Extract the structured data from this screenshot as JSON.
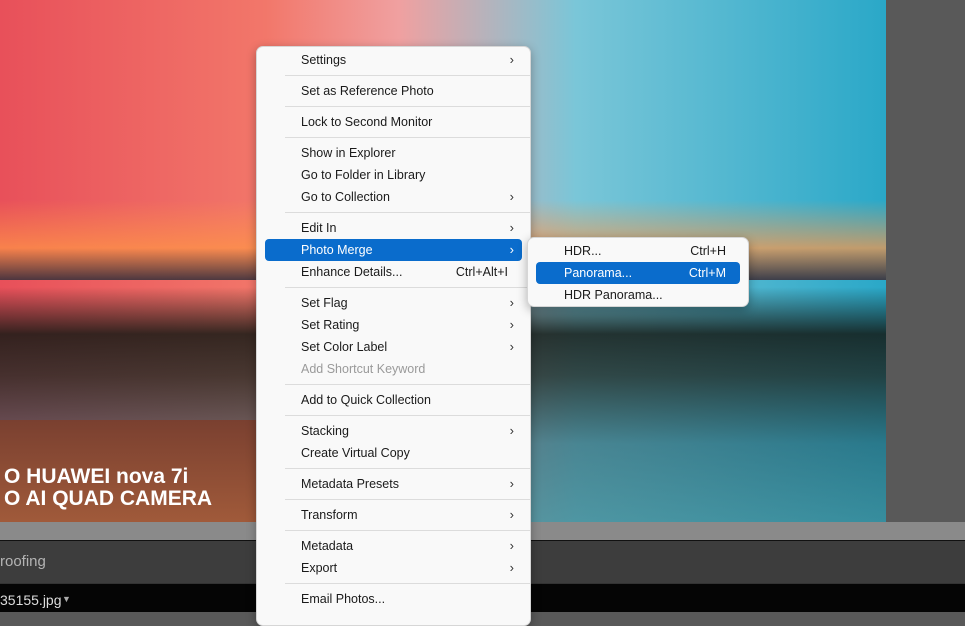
{
  "photo": {
    "watermark_line1": "O  HUAWEI nova 7i",
    "watermark_line2": "O  AI QUAD CAMERA"
  },
  "toolbar": {
    "label": "roofing"
  },
  "filmstrip": {
    "filename": "35155.jpg",
    "caret": "▼"
  },
  "context_menu": {
    "items": [
      {
        "type": "item",
        "label": "Settings",
        "submenu": true
      },
      {
        "type": "sep"
      },
      {
        "type": "item",
        "label": "Set as Reference Photo"
      },
      {
        "type": "sep"
      },
      {
        "type": "item",
        "label": "Lock to Second Monitor"
      },
      {
        "type": "sep"
      },
      {
        "type": "item",
        "label": "Show in Explorer"
      },
      {
        "type": "item",
        "label": "Go to Folder in Library"
      },
      {
        "type": "item",
        "label": "Go to Collection",
        "submenu": true
      },
      {
        "type": "sep"
      },
      {
        "type": "item",
        "label": "Edit In",
        "submenu": true
      },
      {
        "type": "item",
        "label": "Photo Merge",
        "submenu": true,
        "selected": true
      },
      {
        "type": "item",
        "label": "Enhance Details...",
        "shortcut": "Ctrl+Alt+I"
      },
      {
        "type": "sep"
      },
      {
        "type": "item",
        "label": "Set Flag",
        "submenu": true
      },
      {
        "type": "item",
        "label": "Set Rating",
        "submenu": true
      },
      {
        "type": "item",
        "label": "Set Color Label",
        "submenu": true
      },
      {
        "type": "item",
        "label": "Add Shortcut Keyword",
        "disabled": true
      },
      {
        "type": "sep"
      },
      {
        "type": "item",
        "label": "Add to Quick Collection"
      },
      {
        "type": "sep"
      },
      {
        "type": "item",
        "label": "Stacking",
        "submenu": true
      },
      {
        "type": "item",
        "label": "Create Virtual Copy"
      },
      {
        "type": "sep"
      },
      {
        "type": "item",
        "label": "Metadata Presets",
        "submenu": true
      },
      {
        "type": "sep"
      },
      {
        "type": "item",
        "label": "Transform",
        "submenu": true
      },
      {
        "type": "sep"
      },
      {
        "type": "item",
        "label": "Metadata",
        "submenu": true
      },
      {
        "type": "item",
        "label": "Export",
        "submenu": true
      },
      {
        "type": "sep"
      },
      {
        "type": "item",
        "label": "Email Photos..."
      }
    ]
  },
  "photo_merge_submenu": {
    "items": [
      {
        "type": "item",
        "label": "HDR...",
        "shortcut": "Ctrl+H"
      },
      {
        "type": "item",
        "label": "Panorama...",
        "shortcut": "Ctrl+M",
        "selected": true
      },
      {
        "type": "item",
        "label": "HDR Panorama..."
      }
    ]
  },
  "icons": {
    "submenu_arrow": "›"
  },
  "colors": {
    "selection": "#0a6ccc"
  }
}
